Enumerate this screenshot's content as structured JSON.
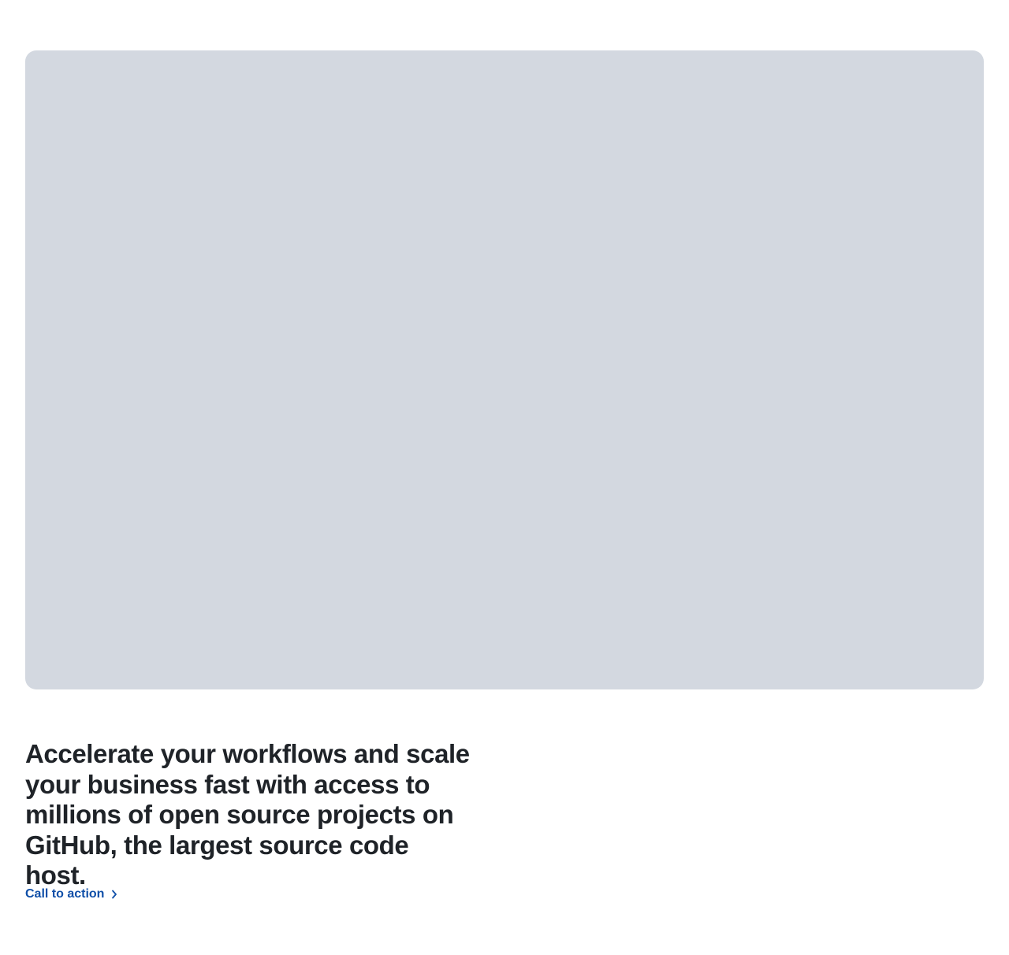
{
  "hero": {
    "headline": "Accelerate your workflows and scale your business fast with access to millions of open source projects on GitHub, the largest source code host.",
    "cta_label": "Call to action",
    "cta_icon": "chevron-right-icon"
  },
  "colors": {
    "placeholder_bg": "#d3d8e0",
    "text": "#1f2328",
    "link": "#0f4fa8"
  }
}
